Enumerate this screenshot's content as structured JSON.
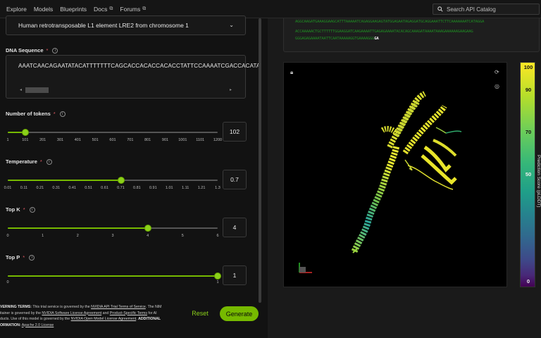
{
  "nav": {
    "items": [
      {
        "label": "Explore",
        "external": false
      },
      {
        "label": "Models",
        "external": false
      },
      {
        "label": "Blueprints",
        "external": false
      },
      {
        "label": "Docs",
        "external": true
      },
      {
        "label": "Forums",
        "external": true
      }
    ],
    "search_placeholder": "Search API Catalog"
  },
  "form": {
    "example_select": "Human retrotransposable L1 element LRE2 from chromosome 1",
    "dna_label": "DNA Sequence",
    "dna_value": "AAATCAACAGAATATACATTTTTTTCAGCACCACACCACACCTATTCCAAAATCGACCACATA",
    "sliders": [
      {
        "key": "tokens",
        "label": "Number of tokens",
        "value": "102",
        "fraction": 0.085,
        "ticks": [
          "1",
          "101",
          "201",
          "301",
          "401",
          "501",
          "601",
          "701",
          "801",
          "901",
          "1001",
          "1101",
          "1200"
        ]
      },
      {
        "key": "temperature",
        "label": "Temperature",
        "value": "0.7",
        "fraction": 0.54,
        "ticks": [
          "0.01",
          "0.11",
          "0.21",
          "0.31",
          "0.41",
          "0.51",
          "0.61",
          "0.71",
          "0.81",
          "0.91",
          "1.01",
          "1.11",
          "1.21",
          "1.3"
        ]
      },
      {
        "key": "topk",
        "label": "Top K",
        "value": "4",
        "fraction": 0.667,
        "ticks": [
          "0",
          "1",
          "2",
          "3",
          "4",
          "5",
          "6"
        ]
      },
      {
        "key": "topp",
        "label": "Top P",
        "value": "1",
        "fraction": 1.0,
        "ticks": [
          "0",
          "1"
        ]
      }
    ],
    "reset_label": "Reset",
    "generate_label": "Generate"
  },
  "terms": {
    "heading": "VERNING TERMS:",
    "t1": " This trial service is governed by the ",
    "l1": "NVIDIA API Trial Terms of Service",
    "t2": ". The NIM",
    "t3": "itainer is governed by the ",
    "l2": "NVIDIA Software License Agreement",
    "t4": " and ",
    "l3": "Product-Specific Terms",
    "t5": " for AI",
    "t6": "ducts. Use of this model is governed by the ",
    "l4": "NVIDIA Open Model License Agreement",
    "t7": ". ",
    "b2": "ADDITIONAL",
    "b3": "ORMATION:",
    "l5": "Apache 2.0 License"
  },
  "output": {
    "lines": [
      "AGGCAAGATGAAAGGAAGCATTTAAAAATCAGAGGAAGAGTATGGAGAATAGAGGATGCAGGAAATTCTTCAAAAAAATCATAGGA",
      "ACCAAAAACTGCTTTTTTGGAAGGATCAAGAAAATTGAGAGAAAATACACAGCAAAGATAAAATAAAGAAAAAAGAAGAAG",
      "GGGAGAGAAAATAATTCAATAAAAAGGTGAAAAGGG"
    ],
    "tail": "GA"
  },
  "colorbar": {
    "ticks": [
      "100",
      "90",
      "70",
      "50",
      "0"
    ],
    "title": "Prediction Score (pLDDT)"
  },
  "colors": {
    "accent": "#76b900",
    "seq_green": "#1e8a22"
  }
}
